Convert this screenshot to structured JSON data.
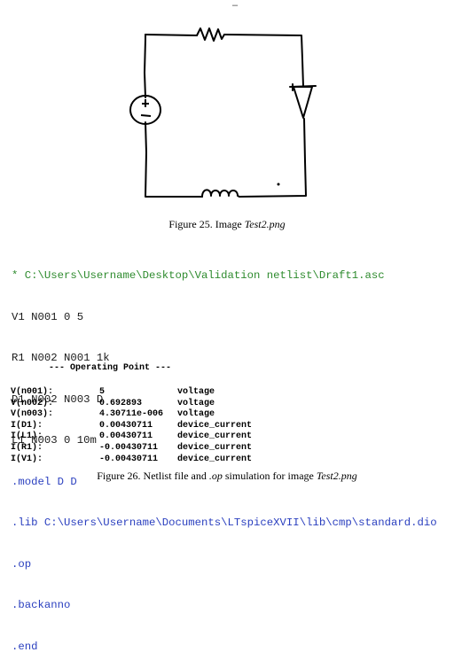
{
  "top_mark": "–",
  "circuit": {
    "source_plus": "+",
    "source_minus": "−"
  },
  "figure25": {
    "prefix": "Figure 25. Image ",
    "name": "Test2.png"
  },
  "netlist": [
    {
      "text": "* C:\\Users\\Username\\Desktop\\Validation netlist\\Draft1.asc",
      "kind": "comment"
    },
    {
      "text": "V1 N001 0 5",
      "kind": "plain"
    },
    {
      "text": "R1 N002 N001 1k",
      "kind": "plain"
    },
    {
      "text": "D1 N002 N003 D",
      "kind": "plain"
    },
    {
      "text": "L1 N003 0 10m",
      "kind": "plain"
    },
    {
      "text": ".model D D",
      "kind": "dir"
    },
    {
      "text": ".lib C:\\Users\\Username\\Documents\\LTspiceXVII\\lib\\cmp\\standard.dio",
      "kind": "dir"
    },
    {
      "text": ".op",
      "kind": "dir"
    },
    {
      "text": ".backanno",
      "kind": "dir"
    },
    {
      "text": ".end",
      "kind": "dir"
    }
  ],
  "operating_point": {
    "title": "--- Operating Point ---",
    "rows": [
      {
        "name": "V(n001):",
        "value": "5",
        "unit": "voltage"
      },
      {
        "name": "V(n002):",
        "value": "0.692893",
        "unit": "voltage"
      },
      {
        "name": "V(n003):",
        "value": "4.30711e-006",
        "unit": "voltage"
      },
      {
        "name": "I(D1):",
        "value": "0.00430711",
        "unit": "device_current"
      },
      {
        "name": "I(L1):",
        "value": "0.00430711",
        "unit": "device_current"
      },
      {
        "name": "I(R1):",
        "value": "-0.00430711",
        "unit": "device_current"
      },
      {
        "name": "I(V1):",
        "value": "-0.00430711",
        "unit": "device_current"
      }
    ]
  },
  "figure26": {
    "prefix": "Figure 26. Netlist file and ",
    "op": ".op",
    "middle": " simulation for image ",
    "name": "Test2.png"
  }
}
